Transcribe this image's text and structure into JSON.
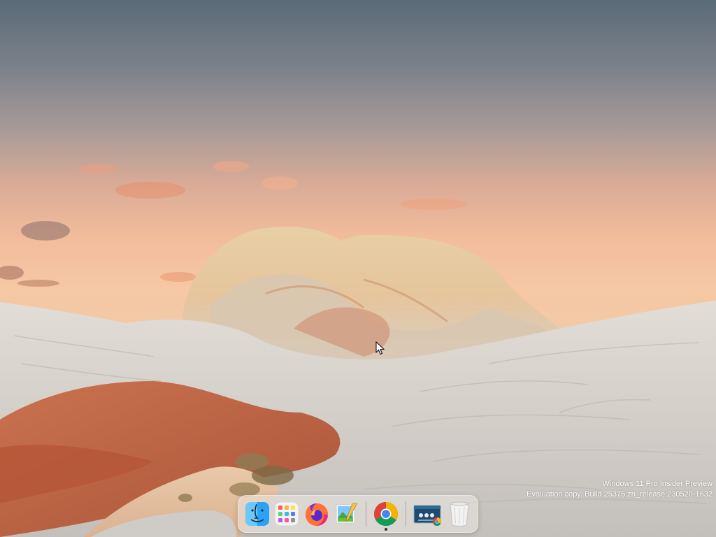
{
  "watermark": {
    "line1": "Windows 11 Pro Insider Preview",
    "line2": "Evaluation copy. Build 25375.zn_release.230520-1632"
  },
  "dock": {
    "items": [
      {
        "id": "finder",
        "icon": "finder-icon",
        "running": false
      },
      {
        "id": "launchpad",
        "icon": "launchpad-icon",
        "running": false
      },
      {
        "id": "firefox",
        "icon": "firefox-icon",
        "running": false
      },
      {
        "id": "preview",
        "icon": "preview-icon",
        "running": false
      },
      {
        "id": "chrome",
        "icon": "chrome-icon",
        "running": true
      },
      {
        "id": "chrome-window",
        "icon": "chrome-window-thumbnail-icon",
        "running": false
      },
      {
        "id": "trash",
        "icon": "trash-icon",
        "running": false
      }
    ]
  },
  "colors": {
    "sky_top": "#5b6b78",
    "sky_glow": "#f6c8a4",
    "rock": "#d8d4ce",
    "red_sand": "#c0583a"
  }
}
